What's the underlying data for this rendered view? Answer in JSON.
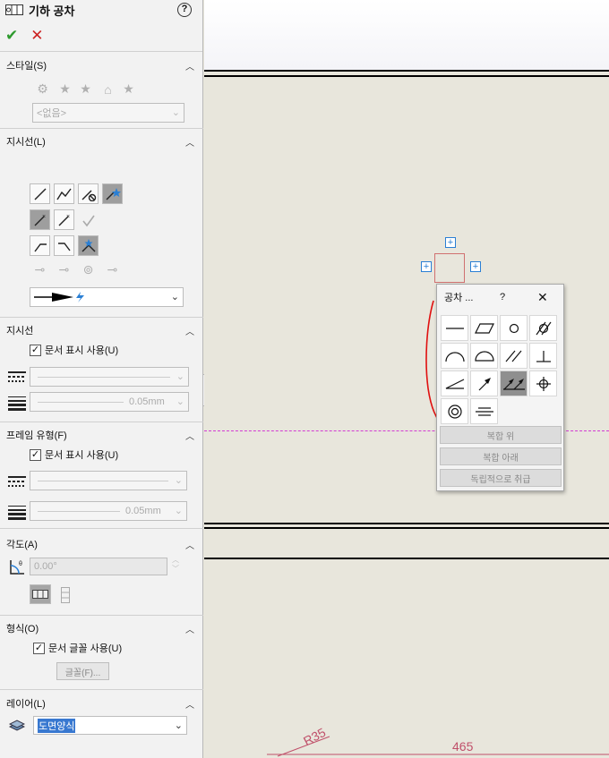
{
  "panel": {
    "title": "기하 공차",
    "help": "?",
    "ok": "✔",
    "cancel": "✕"
  },
  "style": {
    "header": "스타일(S)",
    "select_value": "<없음>"
  },
  "leader": {
    "header": "지시선(L)",
    "style_combo_value": ""
  },
  "leader_display": {
    "header": "지시선",
    "use_doc_display": "문서 표시 사용(U)",
    "thickness": "0.05mm"
  },
  "frame": {
    "header": "프레임 유형(F)",
    "use_doc_display": "문서 표시 사용(U)",
    "thickness": "0.05mm"
  },
  "angle": {
    "header": "각도(A)",
    "value": "0.00°"
  },
  "format": {
    "header": "형식(O)",
    "use_doc_font": "문서 글꼴 사용(U)",
    "font_button": "글꼴(F)..."
  },
  "layer": {
    "header": "레이어(L)",
    "value": "도면양식"
  },
  "canvas": {
    "dim_r": "R35",
    "dim_465": "465"
  },
  "popup": {
    "title": "공차 ...",
    "help": "?",
    "close": "✕",
    "btn_composite_above": "복합 위",
    "btn_composite_below": "복합 아래",
    "btn_independent": "독립적으로 취급"
  },
  "colors": {
    "accent_blue": "#2a7fd4",
    "ok_green": "#2e9a2e",
    "cancel_red": "#cc2222",
    "selection": "#3878d0"
  }
}
